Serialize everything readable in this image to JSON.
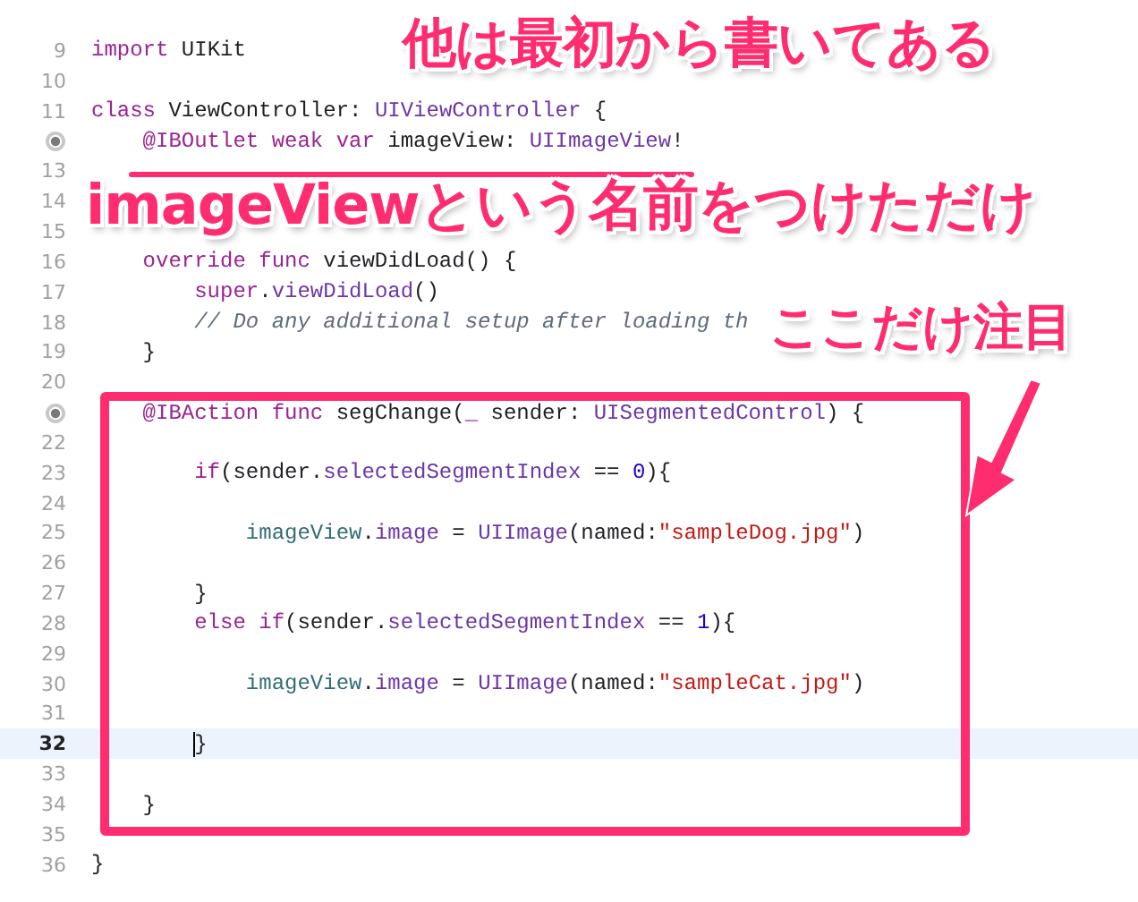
{
  "editor": {
    "lines": [
      {
        "number": "9",
        "outlet": false,
        "current": false,
        "tokens": [
          {
            "text": "import",
            "kind": "keyword"
          },
          {
            "text": " UIKit",
            "kind": "plain"
          }
        ]
      },
      {
        "number": "10",
        "outlet": false,
        "current": false
      },
      {
        "number": "11",
        "outlet": false,
        "current": false,
        "tokens": [
          {
            "text": "class",
            "kind": "keyword"
          },
          {
            "text": " ViewController: ",
            "kind": "plain"
          },
          {
            "text": "UIViewController",
            "kind": "type"
          },
          {
            "text": " {",
            "kind": "plain"
          }
        ]
      },
      {
        "outlet": true,
        "current": false,
        "tokens": [
          {
            "text": "    @IBOutlet weak var",
            "kind": "keyword"
          },
          {
            "text": " imageView: ",
            "kind": "plain"
          },
          {
            "text": "UIImageView",
            "kind": "type"
          },
          {
            "text": "!",
            "kind": "plain"
          }
        ]
      },
      {
        "number": "13",
        "outlet": false,
        "current": false
      },
      {
        "number": "14",
        "outlet": false,
        "current": false
      },
      {
        "number": "15",
        "outlet": false,
        "current": false
      },
      {
        "number": "16",
        "outlet": false,
        "current": false,
        "tokens": [
          {
            "text": "    override func",
            "kind": "keyword"
          },
          {
            "text": " viewDidLoad() {",
            "kind": "plain"
          }
        ]
      },
      {
        "number": "17",
        "outlet": false,
        "current": false,
        "tokens": [
          {
            "text": "        super",
            "kind": "keyword"
          },
          {
            "text": ".",
            "kind": "plain"
          },
          {
            "text": "viewDidLoad",
            "kind": "type"
          },
          {
            "text": "()",
            "kind": "plain"
          }
        ]
      },
      {
        "number": "18",
        "outlet": false,
        "current": false,
        "tokens": [
          {
            "text": "        // Do any additional setup after loading th",
            "kind": "comment"
          }
        ]
      },
      {
        "number": "19",
        "outlet": false,
        "current": false,
        "tokens": [
          {
            "text": "    }",
            "kind": "plain"
          }
        ]
      },
      {
        "number": "20",
        "outlet": false,
        "current": false
      },
      {
        "outlet": true,
        "current": false,
        "tokens": [
          {
            "text": "    @IBAction func",
            "kind": "keyword"
          },
          {
            "text": " segChange(",
            "kind": "plain"
          },
          {
            "text": "_",
            "kind": "keyword"
          },
          {
            "text": " sender: ",
            "kind": "plain"
          },
          {
            "text": "UISegmentedControl",
            "kind": "type"
          },
          {
            "text": ") {",
            "kind": "plain"
          }
        ]
      },
      {
        "number": "22",
        "outlet": false,
        "current": false
      },
      {
        "number": "23",
        "outlet": false,
        "current": false,
        "tokens": [
          {
            "text": "        if",
            "kind": "keyword"
          },
          {
            "text": "(sender.",
            "kind": "plain"
          },
          {
            "text": "selectedSegmentIndex",
            "kind": "type"
          },
          {
            "text": " == ",
            "kind": "plain"
          },
          {
            "text": "0",
            "kind": "number"
          },
          {
            "text": "){",
            "kind": "plain"
          }
        ]
      },
      {
        "number": "24",
        "outlet": false,
        "current": false
      },
      {
        "number": "25",
        "outlet": false,
        "current": false,
        "tokens": [
          {
            "text": "            imageView",
            "kind": "property"
          },
          {
            "text": ".",
            "kind": "plain"
          },
          {
            "text": "image",
            "kind": "type"
          },
          {
            "text": " = ",
            "kind": "plain"
          },
          {
            "text": "UIImage",
            "kind": "type"
          },
          {
            "text": "(named:",
            "kind": "plain"
          },
          {
            "text": "\"sampleDog.jpg\"",
            "kind": "string"
          },
          {
            "text": ")",
            "kind": "plain"
          }
        ]
      },
      {
        "number": "26",
        "outlet": false,
        "current": false
      },
      {
        "number": "27",
        "outlet": false,
        "current": false,
        "tokens": [
          {
            "text": "        }",
            "kind": "plain"
          }
        ]
      },
      {
        "number": "28",
        "outlet": false,
        "current": false,
        "tokens": [
          {
            "text": "        else if",
            "kind": "keyword"
          },
          {
            "text": "(sender.",
            "kind": "plain"
          },
          {
            "text": "selectedSegmentIndex",
            "kind": "type"
          },
          {
            "text": " == ",
            "kind": "plain"
          },
          {
            "text": "1",
            "kind": "number"
          },
          {
            "text": "){",
            "kind": "plain"
          }
        ]
      },
      {
        "number": "29",
        "outlet": false,
        "current": false
      },
      {
        "number": "30",
        "outlet": false,
        "current": false,
        "tokens": [
          {
            "text": "            imageView",
            "kind": "property"
          },
          {
            "text": ".",
            "kind": "plain"
          },
          {
            "text": "image",
            "kind": "type"
          },
          {
            "text": " = ",
            "kind": "plain"
          },
          {
            "text": "UIImage",
            "kind": "type"
          },
          {
            "text": "(named:",
            "kind": "plain"
          },
          {
            "text": "\"sampleCat.jpg\"",
            "kind": "string"
          },
          {
            "text": ")",
            "kind": "plain"
          }
        ]
      },
      {
        "number": "31",
        "outlet": false,
        "current": false
      },
      {
        "number": "32",
        "outlet": false,
        "current": true,
        "tokens": [
          {
            "text": "        }",
            "kind": "plain"
          }
        ]
      },
      {
        "number": "33",
        "outlet": false,
        "current": false
      },
      {
        "number": "34",
        "outlet": false,
        "current": false,
        "tokens": [
          {
            "text": "    }",
            "kind": "plain"
          }
        ]
      },
      {
        "number": "35",
        "outlet": false,
        "current": false
      },
      {
        "number": "36",
        "outlet": false,
        "current": false,
        "tokens": [
          {
            "text": "}",
            "kind": "plain"
          }
        ]
      }
    ]
  },
  "annotations": [
    {
      "text": "他は最初から書いてある"
    },
    {
      "text": "imageViewという名前をつけただけ"
    },
    {
      "text": "ここだけ注目"
    }
  ]
}
